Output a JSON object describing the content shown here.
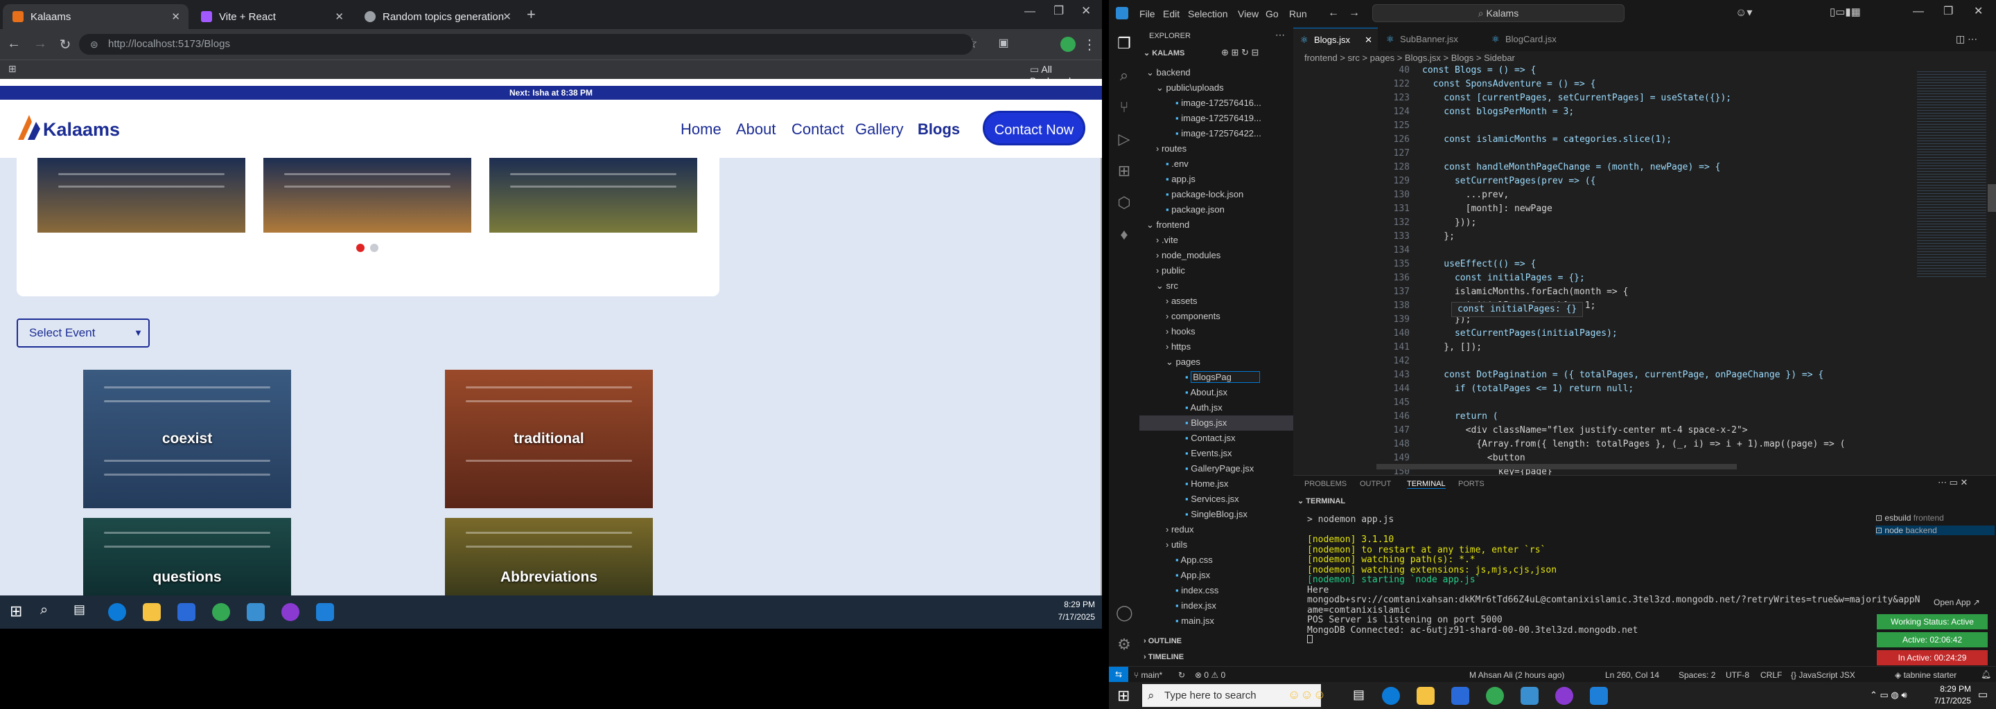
{
  "browser": {
    "tabs": [
      {
        "title": "Kalaams",
        "color": "#e8701a"
      },
      {
        "title": "Vite + React",
        "color": "#a259ff"
      },
      {
        "title": "Random topics generation",
        "color": "#9aa0a6"
      }
    ],
    "url": "http://localhost:5173/Blogs",
    "all_bookmarks": "All Bookmarks"
  },
  "site": {
    "notice": "Next: Isha at 8:38 PM",
    "logo": "Kalaams",
    "nav": [
      "Home",
      "About",
      "Contact",
      "Gallery",
      "Blogs"
    ],
    "contact_button": "Contact Now",
    "select_event": "Select Event",
    "cards": [
      {
        "label": "coexist",
        "color": "#2e4a6e"
      },
      {
        "label": "traditional",
        "color": "#8a3a1f"
      },
      {
        "label": "questions",
        "color": "#1d4a48"
      },
      {
        "label": "Abbreviations",
        "color": "#5a5a2a"
      }
    ]
  },
  "vscode": {
    "menu": [
      "File",
      "Edit",
      "Selection",
      "View",
      "Go",
      "Run"
    ],
    "search": "Kalams",
    "explorer_title": "EXPLORER",
    "project": "KALAMS",
    "tree": [
      {
        "name": "backend",
        "indent": 0,
        "kind": "folder-open"
      },
      {
        "name": "public\\uploads",
        "indent": 1,
        "kind": "folder-open"
      },
      {
        "name": "image-172576416...",
        "indent": 2,
        "kind": "file"
      },
      {
        "name": "image-172576419...",
        "indent": 2,
        "kind": "file"
      },
      {
        "name": "image-172576422...",
        "indent": 2,
        "kind": "file"
      },
      {
        "name": "routes",
        "indent": 1,
        "kind": "folder"
      },
      {
        "name": ".env",
        "indent": 1,
        "kind": "file"
      },
      {
        "name": "app.js",
        "indent": 1,
        "kind": "file"
      },
      {
        "name": "package-lock.json",
        "indent": 1,
        "kind": "file"
      },
      {
        "name": "package.json",
        "indent": 1,
        "kind": "file"
      },
      {
        "name": "frontend",
        "indent": 0,
        "kind": "folder-open"
      },
      {
        "name": ".vite",
        "indent": 1,
        "kind": "folder"
      },
      {
        "name": "node_modules",
        "indent": 1,
        "kind": "folder"
      },
      {
        "name": "public",
        "indent": 1,
        "kind": "folder"
      },
      {
        "name": "src",
        "indent": 1,
        "kind": "folder-open"
      },
      {
        "name": "assets",
        "indent": 2,
        "kind": "folder"
      },
      {
        "name": "components",
        "indent": 2,
        "kind": "folder"
      },
      {
        "name": "hooks",
        "indent": 2,
        "kind": "folder"
      },
      {
        "name": "https",
        "indent": 2,
        "kind": "folder"
      },
      {
        "name": "pages",
        "indent": 2,
        "kind": "folder-open"
      },
      {
        "name": "BlogsPag",
        "indent": 3,
        "kind": "rename"
      },
      {
        "name": "About.jsx",
        "indent": 3,
        "kind": "file"
      },
      {
        "name": "Auth.jsx",
        "indent": 3,
        "kind": "file"
      },
      {
        "name": "Blogs.jsx",
        "indent": 3,
        "kind": "selected"
      },
      {
        "name": "Contact.jsx",
        "indent": 3,
        "kind": "file"
      },
      {
        "name": "Events.jsx",
        "indent": 3,
        "kind": "file"
      },
      {
        "name": "GalleryPage.jsx",
        "indent": 3,
        "kind": "file"
      },
      {
        "name": "Home.jsx",
        "indent": 3,
        "kind": "file"
      },
      {
        "name": "Services.jsx",
        "indent": 3,
        "kind": "file"
      },
      {
        "name": "SingleBlog.jsx",
        "indent": 3,
        "kind": "file"
      },
      {
        "name": "redux",
        "indent": 2,
        "kind": "folder"
      },
      {
        "name": "utils",
        "indent": 2,
        "kind": "folder"
      },
      {
        "name": "App.css",
        "indent": 2,
        "kind": "file"
      },
      {
        "name": "App.jsx",
        "indent": 2,
        "kind": "file"
      },
      {
        "name": "index.css",
        "indent": 2,
        "kind": "file"
      },
      {
        "name": "index.jsx",
        "indent": 2,
        "kind": "file"
      },
      {
        "name": "main.jsx",
        "indent": 2,
        "kind": "file"
      }
    ],
    "outline": "OUTLINE",
    "timeline": "TIMELINE",
    "editor_tabs": [
      "Blogs.jsx",
      "SubBanner.jsx",
      "BlogCard.jsx"
    ],
    "breadcrumb": "frontend > src > pages > Blogs.jsx > Blogs > Sidebar",
    "code_lines": [
      {
        "n": "40",
        "t": "const Blogs = () => {"
      },
      {
        "n": "122",
        "t": "  const SponsAdventure = () => {"
      },
      {
        "n": "123",
        "t": "    const [currentPages, setCurrentPages] = useState({});"
      },
      {
        "n": "124",
        "t": "    const blogsPerMonth = 3;"
      },
      {
        "n": "125",
        "t": ""
      },
      {
        "n": "126",
        "t": "    const islamicMonths = categories.slice(1);"
      },
      {
        "n": "127",
        "t": ""
      },
      {
        "n": "128",
        "t": "    const handleMonthPageChange = (month, newPage) => {"
      },
      {
        "n": "129",
        "t": "      setCurrentPages(prev => ({"
      },
      {
        "n": "130",
        "t": "        ...prev,"
      },
      {
        "n": "131",
        "t": "        [month]: newPage"
      },
      {
        "n": "132",
        "t": "      }));"
      },
      {
        "n": "133",
        "t": "    };"
      },
      {
        "n": "134",
        "t": ""
      },
      {
        "n": "135",
        "t": "    useEffect(() => {"
      },
      {
        "n": "136",
        "t": "      const initialPages = {};"
      },
      {
        "n": "137",
        "t": "      islamicMonths.forEach(month => {"
      },
      {
        "n": "138",
        "t": "        initialPages[month] = 1;"
      },
      {
        "n": "139",
        "t": "      });"
      },
      {
        "n": "140",
        "t": "      setCurrentPages(initialPages);"
      },
      {
        "n": "141",
        "t": "    }, []);"
      },
      {
        "n": "142",
        "t": ""
      },
      {
        "n": "143",
        "t": "    const DotPagination = ({ totalPages, currentPage, onPageChange }) => {"
      },
      {
        "n": "144",
        "t": "      if (totalPages <= 1) return null;"
      },
      {
        "n": "145",
        "t": ""
      },
      {
        "n": "146",
        "t": "      return ("
      },
      {
        "n": "147",
        "t": "        <div className=\"flex justify-center mt-4 space-x-2\">"
      },
      {
        "n": "148",
        "t": "          {Array.from({ length: totalPages }, (_, i) => i + 1).map((page) => ("
      },
      {
        "n": "149",
        "t": "            <button"
      },
      {
        "n": "150",
        "t": "              key={page}"
      }
    ],
    "hover_tip": "const initialPages: {}",
    "panel_tabs": [
      "PROBLEMS",
      "OUTPUT",
      "TERMINAL",
      "PORTS"
    ],
    "terminal_title": "TERMINAL",
    "terminal_lines": [
      {
        "t": "> nodemon app.js",
        "c": "#cccccc"
      },
      {
        "t": "",
        "c": "#cccccc"
      },
      {
        "t": "[nodemon] 3.1.10",
        "c": "#e5e510"
      },
      {
        "t": "[nodemon] to restart at any time, enter `rs`",
        "c": "#e5e510"
      },
      {
        "t": "[nodemon] watching path(s): *.*",
        "c": "#e5e510"
      },
      {
        "t": "[nodemon] watching extensions: js,mjs,cjs,json",
        "c": "#e5e510"
      },
      {
        "t": "[nodemon] starting `node app.js`",
        "c": "#23d18b"
      },
      {
        "t": "Here",
        "c": "#cccccc"
      },
      {
        "t": "mongodb+srv://comtanixahsan:dkKMr6tTd66Z4uL@comtanixislamic.3tel3zd.mongodb.net/?retryWrites=true&w=majority&appN",
        "c": "#cccccc"
      },
      {
        "t": "ame=comtanixislamic",
        "c": "#cccccc"
      },
      {
        "t": "POS Server is listening on port 5000",
        "c": "#cccccc"
      },
      {
        "t": "MongoDB Connected: ac-6utjz91-shard-00-00.3tel3zd.mongodb.net",
        "c": "#cccccc"
      }
    ],
    "terminal_sessions": [
      {
        "name": "esbuild",
        "sub": "frontend"
      },
      {
        "name": "node",
        "sub": "backend"
      }
    ],
    "open_app": "Open App ↗",
    "working_status": "Working Status: Active",
    "active_time": "Active: 02:06:42",
    "inactive_time": "In Active: 00:24:29",
    "status": {
      "branch": "main*",
      "errors": "⊗ 0 ⚠ 0",
      "git": "M Ahsan Ali (2 hours ago)",
      "position": "Ln 260, Col 14",
      "spaces": "Spaces: 2",
      "encoding": "UTF-8",
      "eol": "CRLF",
      "lang": "{} JavaScript JSX",
      "tabnine": "tabnine starter"
    }
  },
  "taskbar_left": {
    "time": "8:29 PM",
    "date": "7/17/2025"
  },
  "taskbar_right": {
    "search": "Type here to search",
    "time": "8:29 PM",
    "date": "7/17/2025"
  }
}
